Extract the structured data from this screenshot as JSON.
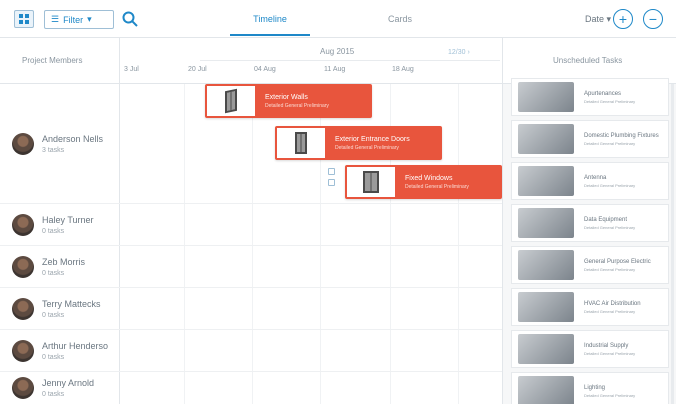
{
  "toolbar": {
    "filter_label": "Filter",
    "tabs": [
      {
        "label": "Timeline",
        "active": true
      },
      {
        "label": "Cards",
        "active": false
      }
    ],
    "date_label": "Date",
    "add_symbol": "+",
    "remove_symbol": "−"
  },
  "timeline": {
    "members_header": "Project Members",
    "month": "Aug 2015",
    "weeks": [
      "3 Jul",
      "20 Jul",
      "04 Aug",
      "11 Aug",
      "18 Aug"
    ],
    "scroll_chip": "12/30 ›",
    "unscheduled_header": "Unscheduled Tasks"
  },
  "members": [
    {
      "name": "Anderson Nells",
      "count": "3 tasks"
    },
    {
      "name": "Haley Turner",
      "count": "0 tasks"
    },
    {
      "name": "Zeb Morris",
      "count": "0 tasks"
    },
    {
      "name": "Terry Mattecks",
      "count": "0 tasks"
    },
    {
      "name": "Arthur Henderso",
      "count": "0 tasks"
    },
    {
      "name": "Jenny Arnold",
      "count": "0 tasks"
    }
  ],
  "tasks": [
    {
      "title": "Exterior Walls",
      "sub": "Detailed General Preliminary"
    },
    {
      "title": "Exterior Entrance Doors",
      "sub": "Detailed General Preliminary"
    },
    {
      "title": "Fixed Windows",
      "sub": "Detailed General Preliminary"
    }
  ],
  "unscheduled": [
    {
      "title": "Apurtenances",
      "sub": "Detailed General Preliminary"
    },
    {
      "title": "Domestic Plumbing Fixtures",
      "sub": "Detailed General Preliminary"
    },
    {
      "title": "Antenna",
      "sub": "Detailed General Preliminary"
    },
    {
      "title": "Data Equipment",
      "sub": "Detailed General Preliminary"
    },
    {
      "title": "General Purpose Electric",
      "sub": "Detailed General Preliminary"
    },
    {
      "title": "HVAC Air Distribution",
      "sub": "Detailed General Preliminary"
    },
    {
      "title": "Industrial Supply",
      "sub": "Detailed General Preliminary"
    },
    {
      "title": "Lighting",
      "sub": "Detailed General Preliminary"
    }
  ],
  "colors": {
    "accent": "#1e88c8",
    "task": "#e8553d"
  }
}
